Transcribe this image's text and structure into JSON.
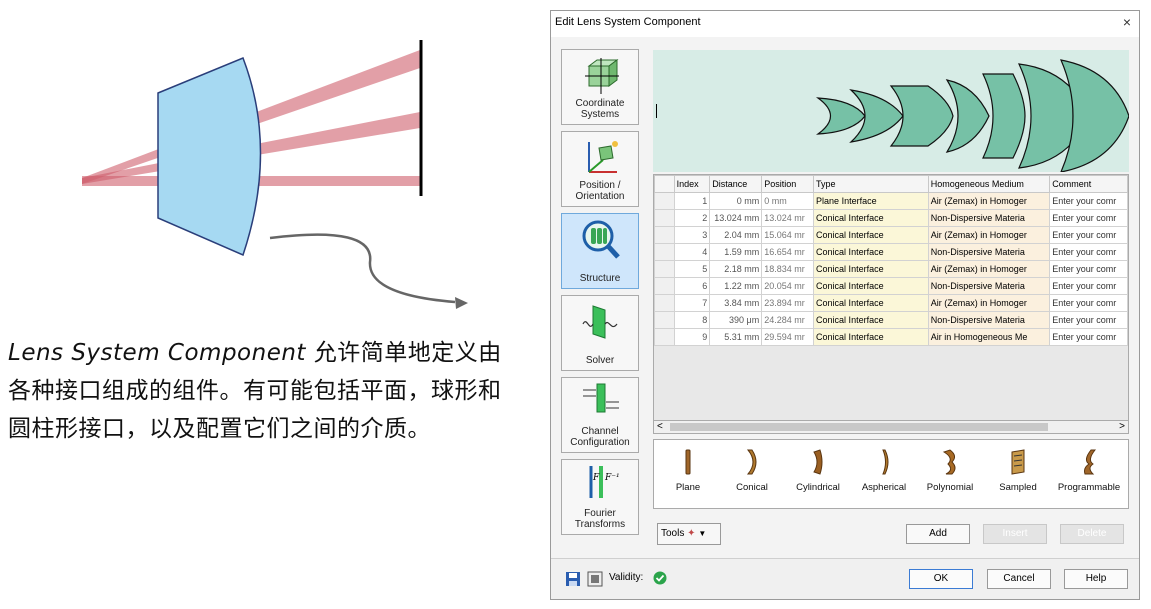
{
  "caption": {
    "italic_part": "Lens System Component",
    "text_part": " 允许简单地定义由各种接口组成的组件。有可能包括平面，球形和圆柱形接口，以及配置它们之间的介质。"
  },
  "dialog": {
    "title": "Edit Lens System Component",
    "close_glyph": "×"
  },
  "sidebar": {
    "items": [
      {
        "label": "Coordinate Systems",
        "icon": "coordinate-systems-icon"
      },
      {
        "label": "Position / Orientation",
        "icon": "position-orientation-icon"
      },
      {
        "label": "Structure",
        "icon": "structure-icon",
        "active": true
      },
      {
        "label": "Solver",
        "icon": "solver-icon"
      },
      {
        "label": "Channel Configuration",
        "icon": "channel-configuration-icon"
      },
      {
        "label": "Fourier Transforms",
        "icon": "fourier-transforms-icon"
      }
    ]
  },
  "table": {
    "headers": [
      "Index",
      "Distance",
      "Position",
      "Type",
      "Homogeneous Medium",
      "Comment"
    ],
    "rows": [
      [
        "1",
        "0 mm",
        "0 mm",
        "Plane Interface",
        "Air (Zemax) in Homoger",
        "Enter your comr"
      ],
      [
        "2",
        "13.024 mm",
        "13.024 mr",
        "Conical Interface",
        "Non-Dispersive Materia",
        "Enter your comr"
      ],
      [
        "3",
        "2.04 mm",
        "15.064 mr",
        "Conical Interface",
        "Air (Zemax) in Homoger",
        "Enter your comr"
      ],
      [
        "4",
        "1.59 mm",
        "16.654 mr",
        "Conical Interface",
        "Non-Dispersive Materia",
        "Enter your comr"
      ],
      [
        "5",
        "2.18 mm",
        "18.834 mr",
        "Conical Interface",
        "Air (Zemax) in Homoger",
        "Enter your comr"
      ],
      [
        "6",
        "1.22 mm",
        "20.054 mr",
        "Conical Interface",
        "Non-Dispersive Materia",
        "Enter your comr"
      ],
      [
        "7",
        "3.84 mm",
        "23.894 mr",
        "Conical Interface",
        "Air (Zemax) in Homoger",
        "Enter your comr"
      ],
      [
        "8",
        "390 μm",
        "24.284 mr",
        "Conical Interface",
        "Non-Dispersive Materia",
        "Enter your comr"
      ],
      [
        "9",
        "5.31 mm",
        "29.594 mr",
        "Conical Interface",
        "Air in Homogeneous Me",
        "Enter your comr"
      ]
    ]
  },
  "scrollbar": {
    "left": "<",
    "right": ">"
  },
  "palette": {
    "items": [
      "Plane",
      "Conical",
      "Cylindrical",
      "Aspherical",
      "Polynomial",
      "Sampled",
      "Programmable"
    ]
  },
  "actions": {
    "tools": "Tools",
    "add": "Add",
    "insert": "Insert",
    "delete": "Delete"
  },
  "footer": {
    "validity": "Validity:",
    "ok": "OK",
    "cancel": "Cancel",
    "help": "Help"
  },
  "colors": {
    "lens_fill": "#a6d9f2",
    "ray": "#cf5f6d",
    "preview_bg": "#d7ece6",
    "element": "#76c1a6",
    "active_tab": "#cfe6fb"
  }
}
